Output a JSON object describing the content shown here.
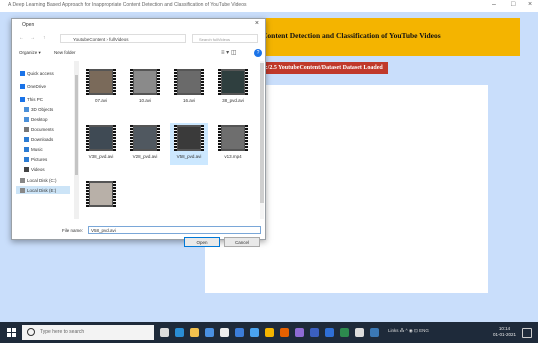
{
  "window": {
    "title": "A Deep Learning Based Approach for Inappropriate Content Detection and Classification of YouTube Videos",
    "controls": [
      "–",
      "□",
      "×"
    ]
  },
  "app": {
    "banner_title": "Content Detection and Classification of YouTube Videos",
    "status_label": "e:/2.5 YoutubeContent/Dataset Dataset Loaded"
  },
  "dialog": {
    "title": "Open",
    "close": "×",
    "nav": [
      "←",
      "→",
      "↑"
    ],
    "path": "YoutubeContent  ›  fullVideos",
    "search_placeholder": "Search fullVideos",
    "organize": "Organize ▾",
    "new_folder": "New folder",
    "view": "≡ ▾  ◫",
    "help": "?",
    "nav_items": [
      {
        "label": "Quick access",
        "icon": "star-icon",
        "color": "#1a73e8"
      },
      {
        "label": "OneDrive",
        "icon": "cloud-icon",
        "color": "#1a73e8"
      },
      {
        "label": "This PC",
        "icon": "computer-icon",
        "color": "#1a73e8"
      },
      {
        "label": "3D Objects",
        "icon": "cube-icon",
        "color": "#4a90d9"
      },
      {
        "label": "Desktop",
        "icon": "desktop-icon",
        "color": "#4a90d9"
      },
      {
        "label": "Documents",
        "icon": "documents-icon",
        "color": "#777777"
      },
      {
        "label": "Downloads",
        "icon": "downloads-icon",
        "color": "#2b7cd3"
      },
      {
        "label": "Music",
        "icon": "music-icon",
        "color": "#2b7cd3"
      },
      {
        "label": "Pictures",
        "icon": "pictures-icon",
        "color": "#2b7cd3"
      },
      {
        "label": "Videos",
        "icon": "videos-icon",
        "color": "#444444"
      },
      {
        "label": "Local Disk (C:)",
        "icon": "drive-icon",
        "color": "#888888"
      },
      {
        "label": "Local Disk (E:)",
        "icon": "drive-icon",
        "color": "#888888"
      }
    ],
    "items": [
      {
        "label": "07.avi",
        "scene": "#7a6a5a"
      },
      {
        "label": "10.avi",
        "scene": "#8a8a8a"
      },
      {
        "label": "16.avi",
        "scene": "#6a6a6a"
      },
      {
        "label": "38_pvd.avi",
        "scene": "#2f3f3f"
      },
      {
        "label": "V38_pvd.avi",
        "scene": "#3f4a54"
      },
      {
        "label": "V28_pvd.avi",
        "scene": "#505860"
      },
      {
        "label": "V58_pvd.avi",
        "scene": "#3a3a3a"
      },
      {
        "label": "v13.mp4",
        "scene": "#6e6e6e"
      },
      {
        "label": "",
        "scene": "#b8b0a8"
      }
    ],
    "file_name_label": "File name:",
    "file_name_value": "V58_pvd.avi",
    "open_button": "Open",
    "cancel_button": "Cancel"
  },
  "taskbar": {
    "search_placeholder": "Type here to search",
    "icons": [
      {
        "name": "task-view-icon",
        "color": "#dddddd"
      },
      {
        "name": "edge-icon",
        "color": "#2a8dd4"
      },
      {
        "name": "file-explorer-icon",
        "color": "#f2c14e"
      },
      {
        "name": "store-icon",
        "color": "#4a90e2"
      },
      {
        "name": "lock-icon",
        "color": "#eeeeee"
      },
      {
        "name": "app-a-icon",
        "color": "#3c7dd9"
      },
      {
        "name": "app-b-icon",
        "color": "#4aa3f0"
      },
      {
        "name": "chrome-icon",
        "color": "#f4b400"
      },
      {
        "name": "firefox-icon",
        "color": "#e66000"
      },
      {
        "name": "app-c-icon",
        "color": "#8e6bd4"
      },
      {
        "name": "app-d-icon",
        "color": "#3b5fc0"
      },
      {
        "name": "app-e-icon",
        "color": "#2f6fd6"
      },
      {
        "name": "app-f-icon",
        "color": "#2d8a4e"
      },
      {
        "name": "app-g-icon",
        "color": "#dddddd"
      },
      {
        "name": "python-icon",
        "color": "#3b78b5"
      }
    ],
    "tray_text": "Links  ⁂  ^  ◉  ⊡  ENG",
    "time": "10:14",
    "date": "01-01-2021"
  }
}
